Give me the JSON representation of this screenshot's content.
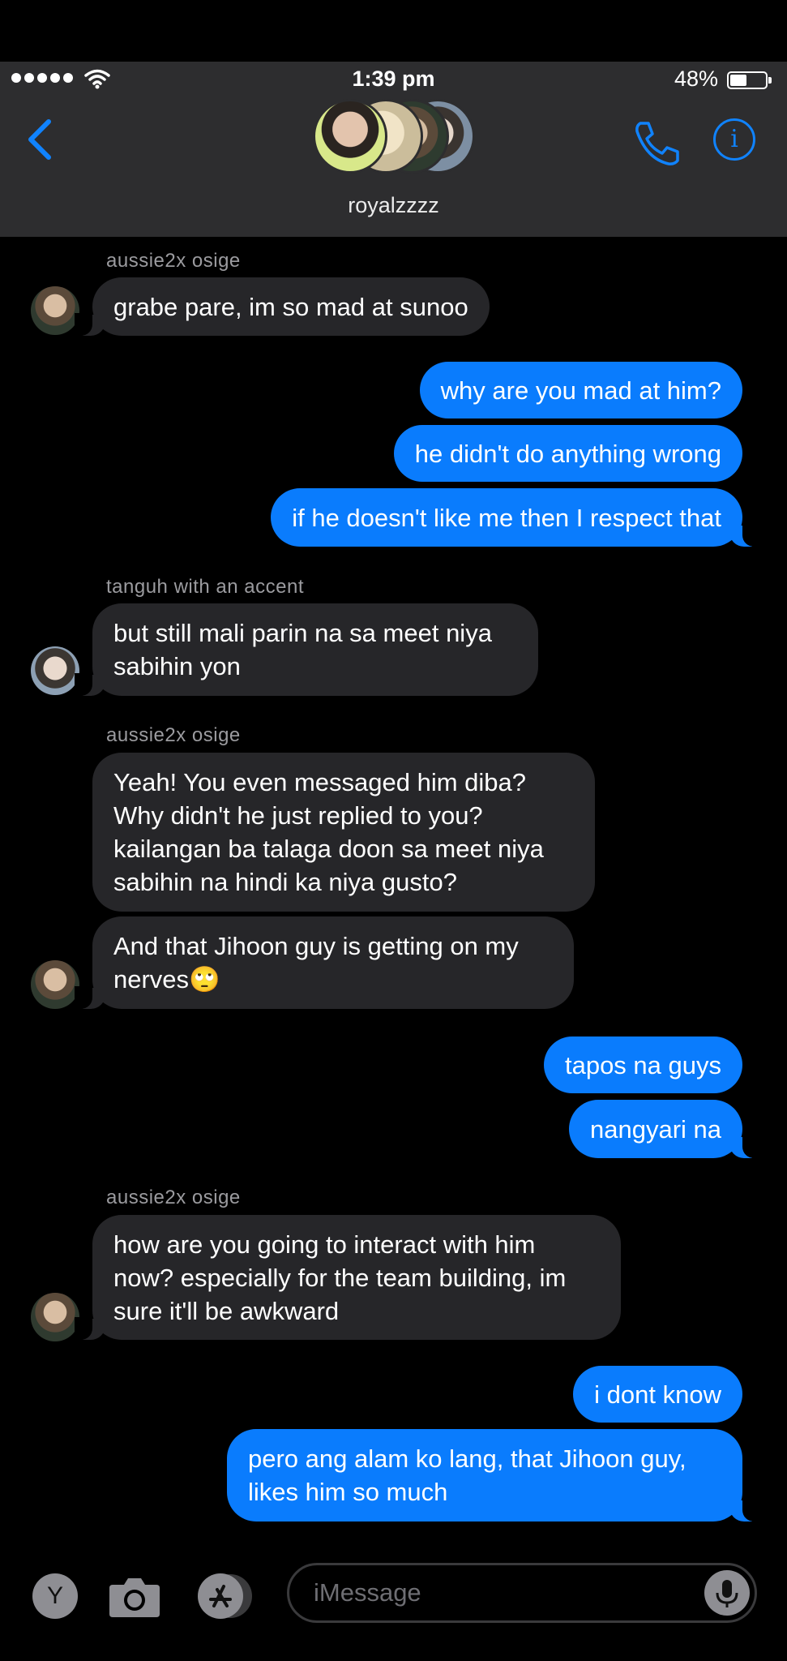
{
  "status_bar": {
    "time": "1:39 pm",
    "battery": "48%"
  },
  "header": {
    "group_name": "royalzzzz"
  },
  "messages": [
    {
      "from": "in",
      "sender": "aussie2x osige",
      "text": "grabe pare, im so mad at sunoo"
    },
    {
      "from": "out",
      "text": "why are you mad at him?"
    },
    {
      "from": "out",
      "text": "he didn't do anything wrong"
    },
    {
      "from": "out",
      "text": "if he doesn't like me then I respect that"
    },
    {
      "from": "in",
      "sender": "tanguh with an accent",
      "text": "but still mali parin na sa meet niya sabihin yon"
    },
    {
      "from": "in",
      "sender": "aussie2x osige",
      "text": "Yeah! You even messaged him diba? Why didn't he just replied to you? kailangan ba talaga doon sa meet niya sabihin na hindi ka niya gusto?"
    },
    {
      "from": "in",
      "text": "And that Jihoon guy is getting on my nerves🙄"
    },
    {
      "from": "out",
      "text": "tapos na guys"
    },
    {
      "from": "out",
      "text": "nangyari na"
    },
    {
      "from": "in",
      "sender": "aussie2x osige",
      "text": "how are you going to interact with him now? especially for the team building, im sure it'll be awkward"
    },
    {
      "from": "out",
      "text": "i dont know"
    },
    {
      "from": "out",
      "text": "pero ang alam ko lang, that Jihoon guy, likes him so much"
    }
  ],
  "input_bar": {
    "app_letter": "Y",
    "placeholder": "iMessage"
  },
  "colors": {
    "header_bg": "#2d2d2f",
    "incoming_bubble": "#262629",
    "outgoing_bubble": "#0a7cfd",
    "accent": "#1083fe"
  },
  "icons": [
    "back-chevron-icon",
    "phone-icon",
    "info-icon",
    "camera-icon",
    "app-store-icon",
    "mic-icon",
    "wifi-icon",
    "battery-icon"
  ]
}
